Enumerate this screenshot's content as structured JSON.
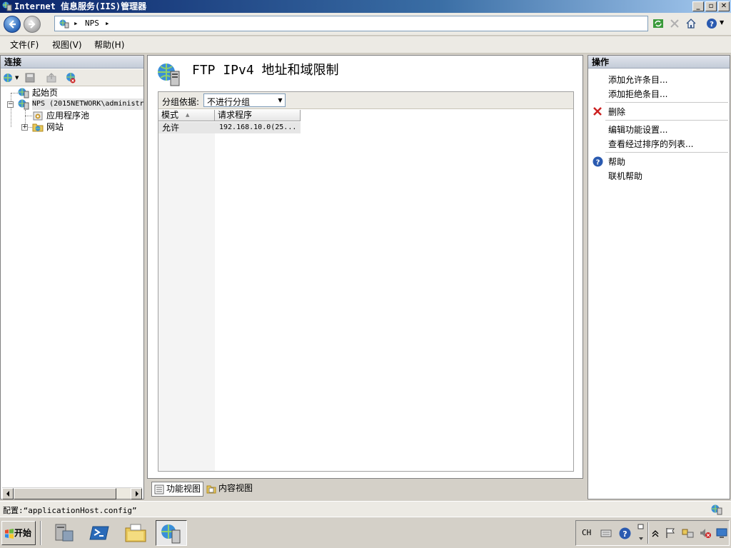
{
  "window": {
    "title": "Internet 信息服务(IIS)管理器",
    "minimize_glyph": "_",
    "maximize_glyph": "▫",
    "close_glyph": "✕"
  },
  "address": {
    "breadcrumb_separator": "▸",
    "crumbs": [
      "NPS"
    ]
  },
  "menu": {
    "items": [
      "文件(F)",
      "视图(V)",
      "帮助(H)"
    ]
  },
  "connections": {
    "title": "连接",
    "tree": {
      "start_page": "起始页",
      "server": "NPS (2015NETWORK\\administr",
      "app_pools": "应用程序池",
      "sites": "网站",
      "collapse_glyph": "−",
      "expand_glyph": "+"
    }
  },
  "feature": {
    "title": "FTP IPv4 地址和域限制",
    "group_by_label": "分组依据:",
    "group_by_value": "不进行分组",
    "columns": [
      "模式",
      "请求程序"
    ],
    "sort_indicator": "▲",
    "rows": [
      {
        "mode": "允许",
        "requestor": "192.168.10.0(25..."
      }
    ]
  },
  "views": {
    "features_view": "功能视图",
    "content_view": "内容视图"
  },
  "actions": {
    "title": "操作",
    "add_allow": "添加允许条目...",
    "add_deny": "添加拒绝条目...",
    "remove": "删除",
    "edit_settings": "编辑功能设置...",
    "view_ordered": "查看经过排序的列表...",
    "help": "帮助",
    "online_help": "联机帮助"
  },
  "status": {
    "config": "配置:“applicationHost.config”"
  },
  "taskbar": {
    "start_label": "开始",
    "language": "CH"
  },
  "colors": {
    "title_gradient_start": "#0a246a",
    "title_gradient_end": "#a6caf0",
    "remove_icon": "#cc2020",
    "help_icon": "#2a5ab0"
  },
  "icons": [
    "iis-app-icon",
    "back-arrow-icon",
    "forward-arrow-icon",
    "globe-server-icon",
    "refresh-icon",
    "stop-icon",
    "home-icon",
    "help-icon",
    "save-icon",
    "connect-icon",
    "folder-icon",
    "globe-icon",
    "remove-x-icon",
    "windows-flag-icon",
    "powershell-icon",
    "explorer-icon",
    "server-manager-icon"
  ]
}
